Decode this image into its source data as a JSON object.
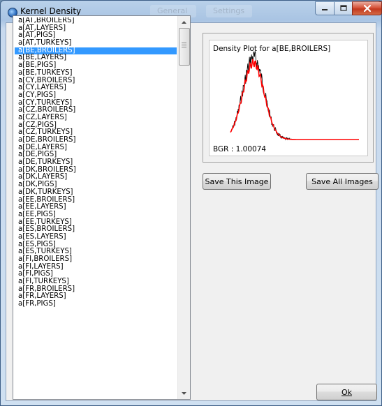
{
  "window": {
    "title": "Kernel Density",
    "ghost_tabs": [
      "General",
      "Settings"
    ]
  },
  "list": {
    "selected_index": 4,
    "items": [
      "a[AT,BROILERS]",
      "a[AT,LAYERS]",
      "a[AT,PIGS]",
      "a[AT,TURKEYS]",
      "a[BE,BROILERS]",
      "a[BE,LAYERS]",
      "a[BE,PIGS]",
      "a[BE,TURKEYS]",
      "a[CY,BROILERS]",
      "a[CY,LAYERS]",
      "a[CY,PIGS]",
      "a[CY,TURKEYS]",
      "a[CZ,BROILERS]",
      "a[CZ,LAYERS]",
      "a[CZ,PIGS]",
      "a[CZ,TURKEYS]",
      "a[DE,BROILERS]",
      "a[DE,LAYERS]",
      "a[DE,PIGS]",
      "a[DE,TURKEYS]",
      "a[DK,BROILERS]",
      "a[DK,LAYERS]",
      "a[DK,PIGS]",
      "a[DK,TURKEYS]",
      "a[EE,BROILERS]",
      "a[EE,LAYERS]",
      "a[EE,PIGS]",
      "a[EE,TURKEYS]",
      "a[ES,BROILERS]",
      "a[ES,LAYERS]",
      "a[ES,PIGS]",
      "a[ES,TURKEYS]",
      "a[FI,BROILERS]",
      "a[FI,LAYERS]",
      "a[FI,PIGS]",
      "a[FI,TURKEYS]",
      "a[FR,BROILERS]",
      "a[FR,LAYERS]",
      "a[FR,PIGS]"
    ]
  },
  "plot": {
    "title": "Density Plot for a[BE,BROILERS]",
    "bgr": "BGR : 1.00074",
    "colors": {
      "kernel": "#000000",
      "smooth": "#ff0000"
    }
  },
  "buttons": {
    "save_this": "Save This Image",
    "save_all": "Save All Images",
    "ok": "Ok"
  },
  "icons": {
    "app": "app-icon",
    "minimize": "minimize-icon",
    "maximize": "maximize-icon",
    "close": "close-icon",
    "scroll_up": "scroll-up-arrow-icon",
    "scroll_down": "scroll-down-arrow-icon"
  }
}
